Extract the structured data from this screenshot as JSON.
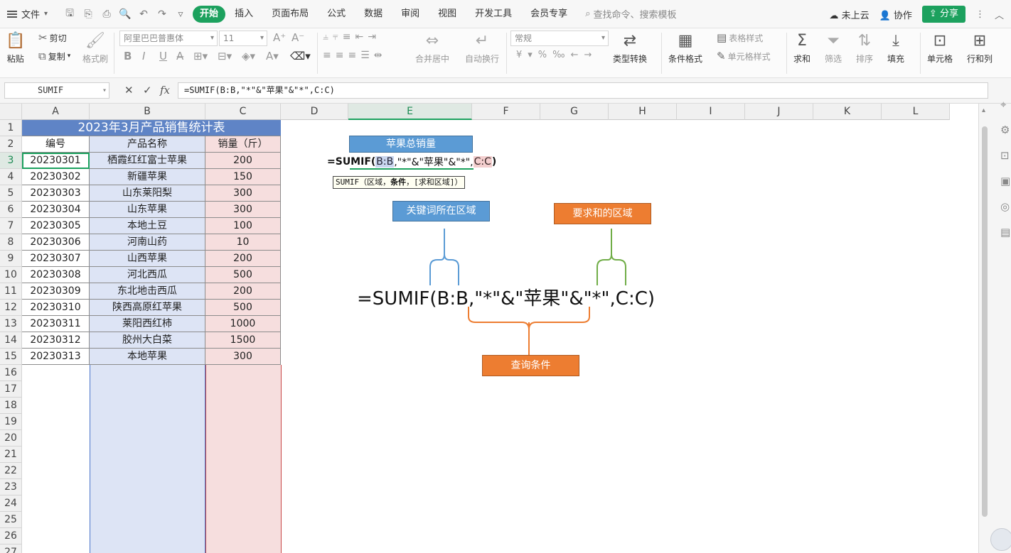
{
  "menubar": {
    "file": "文件",
    "tabs": [
      "开始",
      "插入",
      "页面布局",
      "公式",
      "数据",
      "审阅",
      "视图",
      "开发工具",
      "会员专享"
    ],
    "active_tab": "开始",
    "search_placeholder": "查找命令、搜索模板",
    "cloud": "未上云",
    "collab": "协作",
    "share": "分享"
  },
  "ribbon": {
    "paste": "粘贴",
    "cut": "剪切",
    "copy": "复制",
    "format_painter": "格式刷",
    "font_name": "阿里巴巴普惠体",
    "font_size": "11",
    "merge": "合并居中",
    "wrap": "自动换行",
    "number_format": "常规",
    "type_convert": "类型转换",
    "cond_format": "条件格式",
    "table_style": "表格样式",
    "cell_style": "单元格样式",
    "sum": "求和",
    "filter": "筛选",
    "sort": "排序",
    "fill": "填充",
    "cell": "单元格",
    "row_col": "行和列"
  },
  "formula_bar": {
    "name_box": "SUMIF",
    "cancel": "✕",
    "confirm": "✓",
    "fx": "fx",
    "formula": "=SUMIF(B:B,\"*\"&\"苹果\"&\"*\",C:C)"
  },
  "columns": [
    "A",
    "B",
    "C",
    "D",
    "E",
    "F",
    "G",
    "H",
    "I",
    "J",
    "K",
    "L"
  ],
  "rows": [
    "1",
    "2",
    "3",
    "4",
    "5",
    "6",
    "7",
    "8",
    "9",
    "10",
    "11",
    "12",
    "13",
    "14",
    "15",
    "16",
    "17",
    "18",
    "19",
    "20",
    "21",
    "22",
    "23",
    "24",
    "25",
    "26",
    "27"
  ],
  "table": {
    "title": "2023年3月产品销售统计表",
    "headers": [
      "编号",
      "产品名称",
      "销量（斤）"
    ],
    "data": [
      [
        "20230301",
        "栖霞红红富士苹果",
        "200"
      ],
      [
        "20230302",
        "新疆苹果",
        "150"
      ],
      [
        "20230303",
        "山东莱阳梨",
        "300"
      ],
      [
        "20230304",
        "山东苹果",
        "300"
      ],
      [
        "20230305",
        "本地土豆",
        "100"
      ],
      [
        "20230306",
        "河南山药",
        "10"
      ],
      [
        "20230307",
        "山西苹果",
        "200"
      ],
      [
        "20230308",
        "河北西瓜",
        "500"
      ],
      [
        "20230309",
        "东北地击西瓜",
        "200"
      ],
      [
        "20230310",
        "陕西高原红苹果",
        "500"
      ],
      [
        "20230311",
        "莱阳西红柿",
        "1000"
      ],
      [
        "20230312",
        "胶州大白菜",
        "1500"
      ],
      [
        "20230313",
        "本地苹果",
        "300"
      ]
    ]
  },
  "annotation": {
    "apple_total": "苹果总销量",
    "edit_prefix": "=SUMIF(",
    "edit_ref_b": "B:B",
    "edit_middle": ",\"*\"&\"苹果\"&\"*\",",
    "edit_ref_c": "C:C",
    "edit_suffix": ")",
    "tooltip_fn": "SUMIF（区域，",
    "tooltip_bold": "条件",
    "tooltip_rest": "，[求和区域]）",
    "keyword_range": "关键词所在区域",
    "sum_range": "要求和的区域",
    "big_formula": "=SUMIF(B:B,\"*\"&\"苹果\"&\"*\",C:C)",
    "query": "查询条件"
  },
  "colors": {
    "accent": "#1ca15e",
    "blue_label": "#5b9bd5",
    "orange_label": "#ed7d31",
    "green_brace": "#70ad47"
  }
}
